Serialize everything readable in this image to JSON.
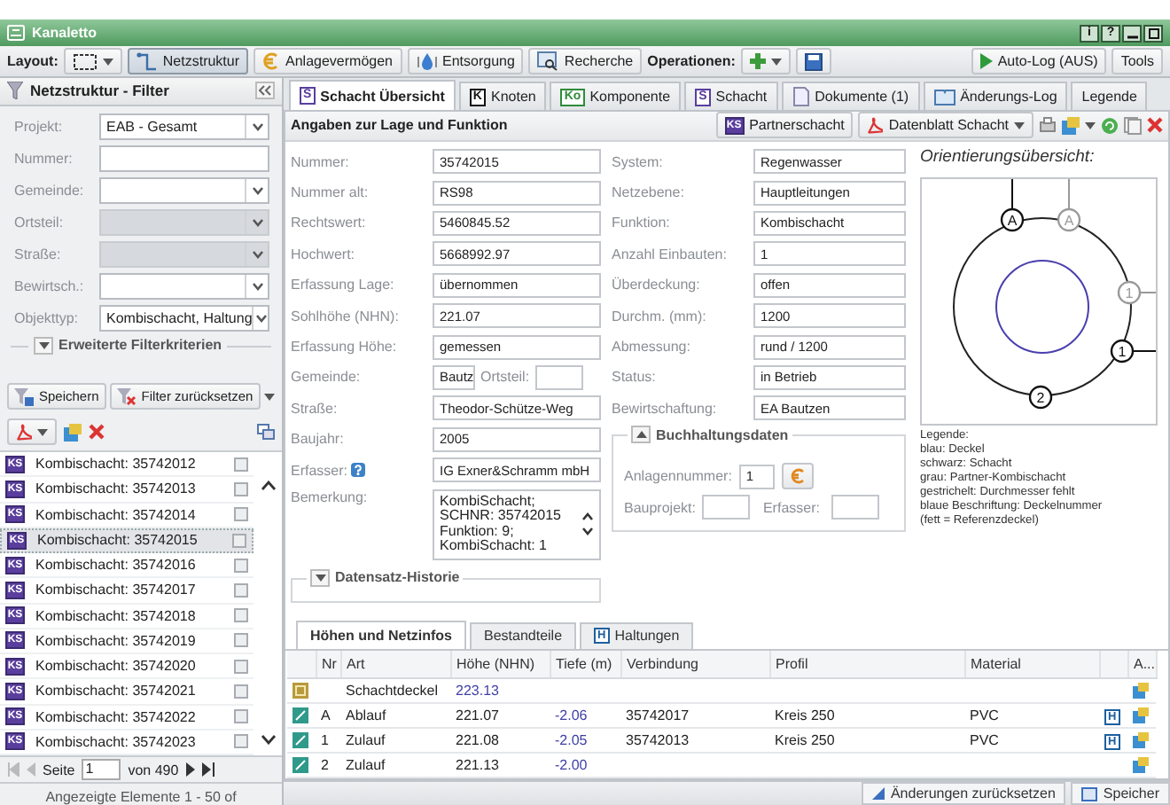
{
  "window": {
    "title": "Kanaletto",
    "help_buttons": [
      "i",
      "?"
    ]
  },
  "toolbar": {
    "layout_label": "Layout:",
    "modules": [
      {
        "label": "Netzstruktur",
        "kind": "network",
        "selected": true
      },
      {
        "label": "Anlagevermögen",
        "kind": "euro",
        "selected": false
      },
      {
        "label": "Entsorgung",
        "kind": "drop",
        "selected": false
      },
      {
        "label": "Recherche",
        "kind": "search",
        "selected": false
      }
    ],
    "operations_label": "Operationen:",
    "autolog": "Auto-Log (AUS)",
    "tools": "Tools"
  },
  "filter": {
    "title": "Netzstruktur - Filter",
    "fields": [
      {
        "label": "Projekt:",
        "value": "EAB - Gesamt",
        "kind": "select",
        "disabled": false
      },
      {
        "label": "Nummer:",
        "kind": "text",
        "disabled": false
      },
      {
        "label": "Gemeinde:",
        "kind": "select",
        "disabled": false
      },
      {
        "label": "Ortsteil:",
        "kind": "select",
        "disabled": true
      },
      {
        "label": "Straße:",
        "kind": "select",
        "disabled": true
      },
      {
        "label": "Bewirtsch.:",
        "kind": "select",
        "disabled": false
      },
      {
        "label": "Objekttyp:",
        "value": "Kombischacht, Haltung",
        "kind": "select",
        "disabled": false
      }
    ],
    "advanced": "Erweiterte Filterkriterien",
    "buttons": [
      "Speichern",
      "Filter zurücksetzen"
    ]
  },
  "results": {
    "items": [
      {
        "badge": "KS",
        "label": "Kombischacht: 35742012",
        "checked": false,
        "selected": false
      },
      {
        "badge": "KS",
        "label": "Kombischacht: 35742013",
        "checked": false,
        "selected": false
      },
      {
        "badge": "KS",
        "label": "Kombischacht: 35742014",
        "checked": false,
        "selected": false
      },
      {
        "badge": "KS",
        "label": "Kombischacht: 35742015",
        "checked": false,
        "selected": true
      },
      {
        "badge": "KS",
        "label": "Kombischacht: 35742016",
        "checked": false,
        "selected": false
      },
      {
        "badge": "KS",
        "label": "Kombischacht: 35742017",
        "checked": false,
        "selected": false
      },
      {
        "badge": "KS",
        "label": "Kombischacht: 35742018",
        "checked": false,
        "selected": false
      },
      {
        "badge": "KS",
        "label": "Kombischacht: 35742019",
        "checked": false,
        "selected": false
      },
      {
        "badge": "KS",
        "label": "Kombischacht: 35742020",
        "checked": false,
        "selected": false
      },
      {
        "badge": "KS",
        "label": "Kombischacht: 35742021",
        "checked": false,
        "selected": false
      },
      {
        "badge": "KS",
        "label": "Kombischacht: 35742022",
        "checked": false,
        "selected": false
      },
      {
        "badge": "KS",
        "label": "Kombischacht: 35742023",
        "checked": false,
        "selected": false
      }
    ],
    "pager": {
      "page_label": "Seite",
      "page": "1",
      "of": "von 490"
    },
    "summary": "Angezeigte Elemente 1 - 50 of"
  },
  "tabs": [
    {
      "badge": "S",
      "color": "#5a3e9e",
      "label": "Schacht Übersicht",
      "kind": "letter",
      "selected": true
    },
    {
      "badge": "K",
      "color": "#111111",
      "label": "Knoten",
      "kind": "letter",
      "selected": false
    },
    {
      "badge": "Ko",
      "color": "#2e8b3a",
      "label": "Komponente",
      "kind": "letter",
      "selected": false
    },
    {
      "badge": "S",
      "color": "#5a3e9e",
      "label": "Schacht",
      "kind": "letter",
      "selected": false
    },
    {
      "label": "Dokumente (1)",
      "kind": "document",
      "selected": false
    },
    {
      "label": "Änderungs-Log",
      "kind": "book",
      "selected": false
    },
    {
      "label": "Legende",
      "kind": "plain",
      "selected": false
    }
  ],
  "detail": {
    "title": "Angaben zur Lage und Funktion",
    "actions": [
      {
        "badge": "KS",
        "label": "Partnerschacht",
        "kind": "badge"
      },
      {
        "label": "Datenblatt Schacht",
        "kind": "pdf"
      }
    ],
    "left_fields": [
      {
        "label": "Nummer:",
        "value": "35742015",
        "kind": "text"
      },
      {
        "label": "Nummer alt:",
        "value": "RS98",
        "kind": "text"
      },
      {
        "label": "Rechtswert:",
        "value": "5460845.52",
        "kind": "text"
      },
      {
        "label": "Hochwert:",
        "value": "5668992.97",
        "kind": "text"
      },
      {
        "label": "Erfassung Lage:",
        "value": "übernommen",
        "kind": "text"
      },
      {
        "label": "Sohlhöhe (NHN):",
        "value": "221.07",
        "kind": "text"
      },
      {
        "label": "Erfassung Höhe:",
        "value": "gemessen",
        "kind": "text"
      },
      {
        "label": "Gemeinde:",
        "value": "Bautz",
        "sub_label": "Ortsteil:",
        "kind": "split"
      },
      {
        "label": "Straße:",
        "value": "Theodor-Schütze-Weg",
        "kind": "text"
      },
      {
        "label": "Baujahr:",
        "value": "2005",
        "kind": "text"
      },
      {
        "label": "Erfasser:",
        "value": "IG Exner&Schramm mbH",
        "kind": "help"
      },
      {
        "label": "Bemerkung:",
        "value": "KombiSchacht;\nSCHNR: 35742015\nFunktion: 9;\nKombiSchacht: 1",
        "kind": "textarea"
      }
    ],
    "right_fields": [
      {
        "label": "System:",
        "value": "Regenwasser"
      },
      {
        "label": "Netzebene:",
        "value": "Hauptleitungen"
      },
      {
        "label": "Funktion:",
        "value": "Kombischacht"
      },
      {
        "label": "Anzahl Einbauten:",
        "value": "1"
      },
      {
        "label": "Überdeckung:",
        "value": "offen"
      },
      {
        "label": "Durchm. (mm):",
        "value": "1200"
      },
      {
        "label": "Abmessung:",
        "value": "rund / 1200"
      },
      {
        "label": "Status:",
        "value": "in Betrieb"
      },
      {
        "label": "Bewirtschaftung:",
        "value": "EA Bautzen"
      }
    ],
    "accounting": {
      "title": "Buchhaltungsdaten",
      "expanded": true,
      "asset_label": "Anlagennummer:",
      "asset_value": "1",
      "project_label": "Bauprojekt:",
      "recorder_label": "Erfasser:"
    },
    "history": {
      "title": "Datensatz-Historie",
      "expanded": false
    }
  },
  "orientation": {
    "title": "Orientierungsübersicht:",
    "markers": [
      {
        "label": "A",
        "kind": "own"
      },
      {
        "label": "A",
        "kind": "partner"
      },
      {
        "label": "1",
        "kind": "partner"
      },
      {
        "label": "1",
        "kind": "own"
      },
      {
        "label": "2",
        "kind": "own"
      }
    ],
    "legend": [
      "Legende:",
      "blau: Deckel",
      "schwarz: Schacht",
      "grau: Partner-Kombischacht",
      "gestrichelt: Durchmesser fehlt",
      "blaue Beschriftung: Deckelnummer",
      "(fett = Referenzdeckel)"
    ]
  },
  "bottom": {
    "tabs": [
      {
        "label": "Höhen und Netzinfos",
        "kind": "plain",
        "selected": true
      },
      {
        "label": "Bestandteile",
        "kind": "plain",
        "selected": false
      },
      {
        "badge": "H",
        "label": "Haltungen",
        "kind": "badge",
        "selected": false
      }
    ],
    "columns": [
      "Nr",
      "Art",
      "Höhe (NHN)",
      "Tiefe (m)",
      "Verbindung",
      "Profil",
      "Material",
      "A..."
    ],
    "rows": [
      {
        "kind": "cover",
        "nr": "",
        "art": "Schachtdeckel",
        "hoehe": "223.13",
        "tiefe": "",
        "verbindung": "",
        "profil": "",
        "material": ""
      },
      {
        "kind": "connection",
        "nr": "A",
        "art": "Ablauf",
        "hoehe": "221.07",
        "tiefe": "-2.06",
        "verbindung": "35742017",
        "profil": "Kreis 250",
        "material": "PVC",
        "link": "H"
      },
      {
        "kind": "connection",
        "nr": "1",
        "art": "Zulauf",
        "hoehe": "221.08",
        "tiefe": "-2.05",
        "verbindung": "35742013",
        "profil": "Kreis 250",
        "material": "PVC",
        "link": "H"
      },
      {
        "kind": "connection",
        "nr": "2",
        "art": "Zulauf",
        "hoehe": "221.13",
        "tiefe": "-2.00",
        "verbindung": "",
        "profil": "",
        "material": ""
      }
    ]
  },
  "status_bar": {
    "buttons": [
      "Änderungen zurücksetzen",
      "Speicher"
    ]
  }
}
